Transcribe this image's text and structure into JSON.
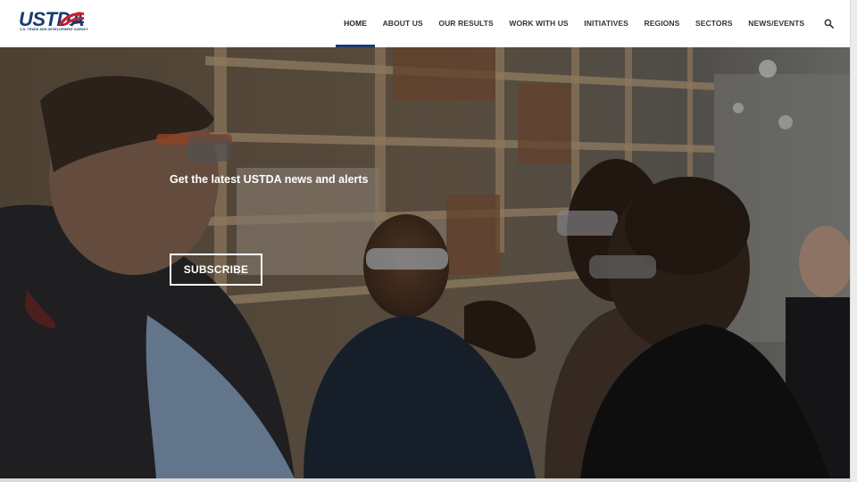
{
  "logo": {
    "text": "USTDA",
    "subtitle": "U.S. TRADE AND DEVELOPMENT AGENCY",
    "colors": {
      "navy": "#1a3a6e",
      "red": "#c8202f"
    }
  },
  "nav": {
    "items": [
      {
        "label": "HOME",
        "active": true
      },
      {
        "label": "ABOUT US",
        "active": false
      },
      {
        "label": "OUR RESULTS",
        "active": false
      },
      {
        "label": "WORK WITH US",
        "active": false
      },
      {
        "label": "INITIATIVES",
        "active": false
      },
      {
        "label": "REGIONS",
        "active": false
      },
      {
        "label": "SECTORS",
        "active": false
      },
      {
        "label": "NEWS/EVENTS",
        "active": false
      }
    ],
    "search_icon": "search-icon",
    "active_color": "#1a3a6e"
  },
  "hero": {
    "heading": "Get the latest USTDA news and alerts",
    "subscribe_label": "SUBSCRIBE",
    "background": "photo of people wearing safety glasses in a warehouse"
  }
}
